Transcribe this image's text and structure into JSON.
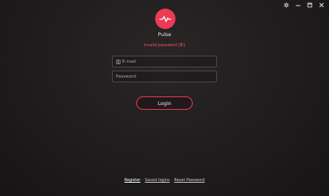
{
  "app": {
    "name": "Pulse"
  },
  "window_controls": [
    "settings-icon",
    "minimize-icon",
    "maximize-icon",
    "close-icon"
  ],
  "error": {
    "text": "Invalid password [IE]"
  },
  "form": {
    "email_placeholder": "E-mail",
    "password_placeholder": "Password",
    "login_label": "Login"
  },
  "footer": {
    "register": "Register",
    "saved_logins": "Saved logins",
    "reset_password": "Reset Password",
    "separator": "·"
  },
  "colors": {
    "accent": "#ee3a55",
    "error": "#ff4e6a",
    "background": "#1e1c1d"
  }
}
